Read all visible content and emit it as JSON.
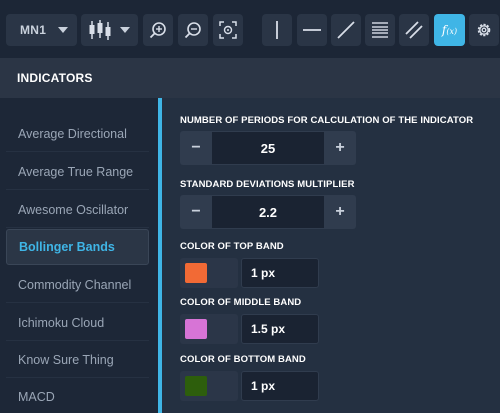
{
  "toolbar": {
    "timeframe": "MN1",
    "tool_icons": [
      "candlestick-icon",
      "zoom-in-icon",
      "zoom-out-icon",
      "fit-screen-icon",
      "vertical-line-icon",
      "horizontal-line-icon",
      "trend-line-icon",
      "fibonacci-icon",
      "channel-icon",
      "function-icon",
      "gear-icon"
    ],
    "fx_label": "f",
    "fx_sub": "(x)",
    "accent_color": "#3fb5e6"
  },
  "panel": {
    "title": "INDICATORS"
  },
  "indicators": [
    {
      "label": "Average Directional",
      "active": false
    },
    {
      "label": "Average True Range",
      "active": false
    },
    {
      "label": "Awesome Oscillator",
      "active": false
    },
    {
      "label": "Bollinger Bands",
      "active": true
    },
    {
      "label": "Commodity Channel",
      "active": false
    },
    {
      "label": "Ichimoku Cloud",
      "active": false
    },
    {
      "label": "Know Sure Thing",
      "active": false
    },
    {
      "label": "MACD",
      "active": false
    }
  ],
  "settings": {
    "periods": {
      "label": "NUMBER OF PERIODS FOR CALCULATION OF THE INDICATOR",
      "value": "25",
      "minus": "−",
      "plus": "+"
    },
    "std_dev": {
      "label": "STANDARD DEVIATIONS MULTIPLIER",
      "value": "2.2",
      "minus": "−",
      "plus": "+"
    },
    "top_band": {
      "label": "COLOR OF TOP BAND",
      "color": "#f26a35",
      "width": "1 px"
    },
    "middle_band": {
      "label": "COLOR OF MIDDLE BAND",
      "color": "#d774d6",
      "width": "1.5 px"
    },
    "bottom_band": {
      "label": "COLOR OF BOTTOM BAND",
      "color": "#2d5e0c",
      "width": "1 px"
    }
  }
}
